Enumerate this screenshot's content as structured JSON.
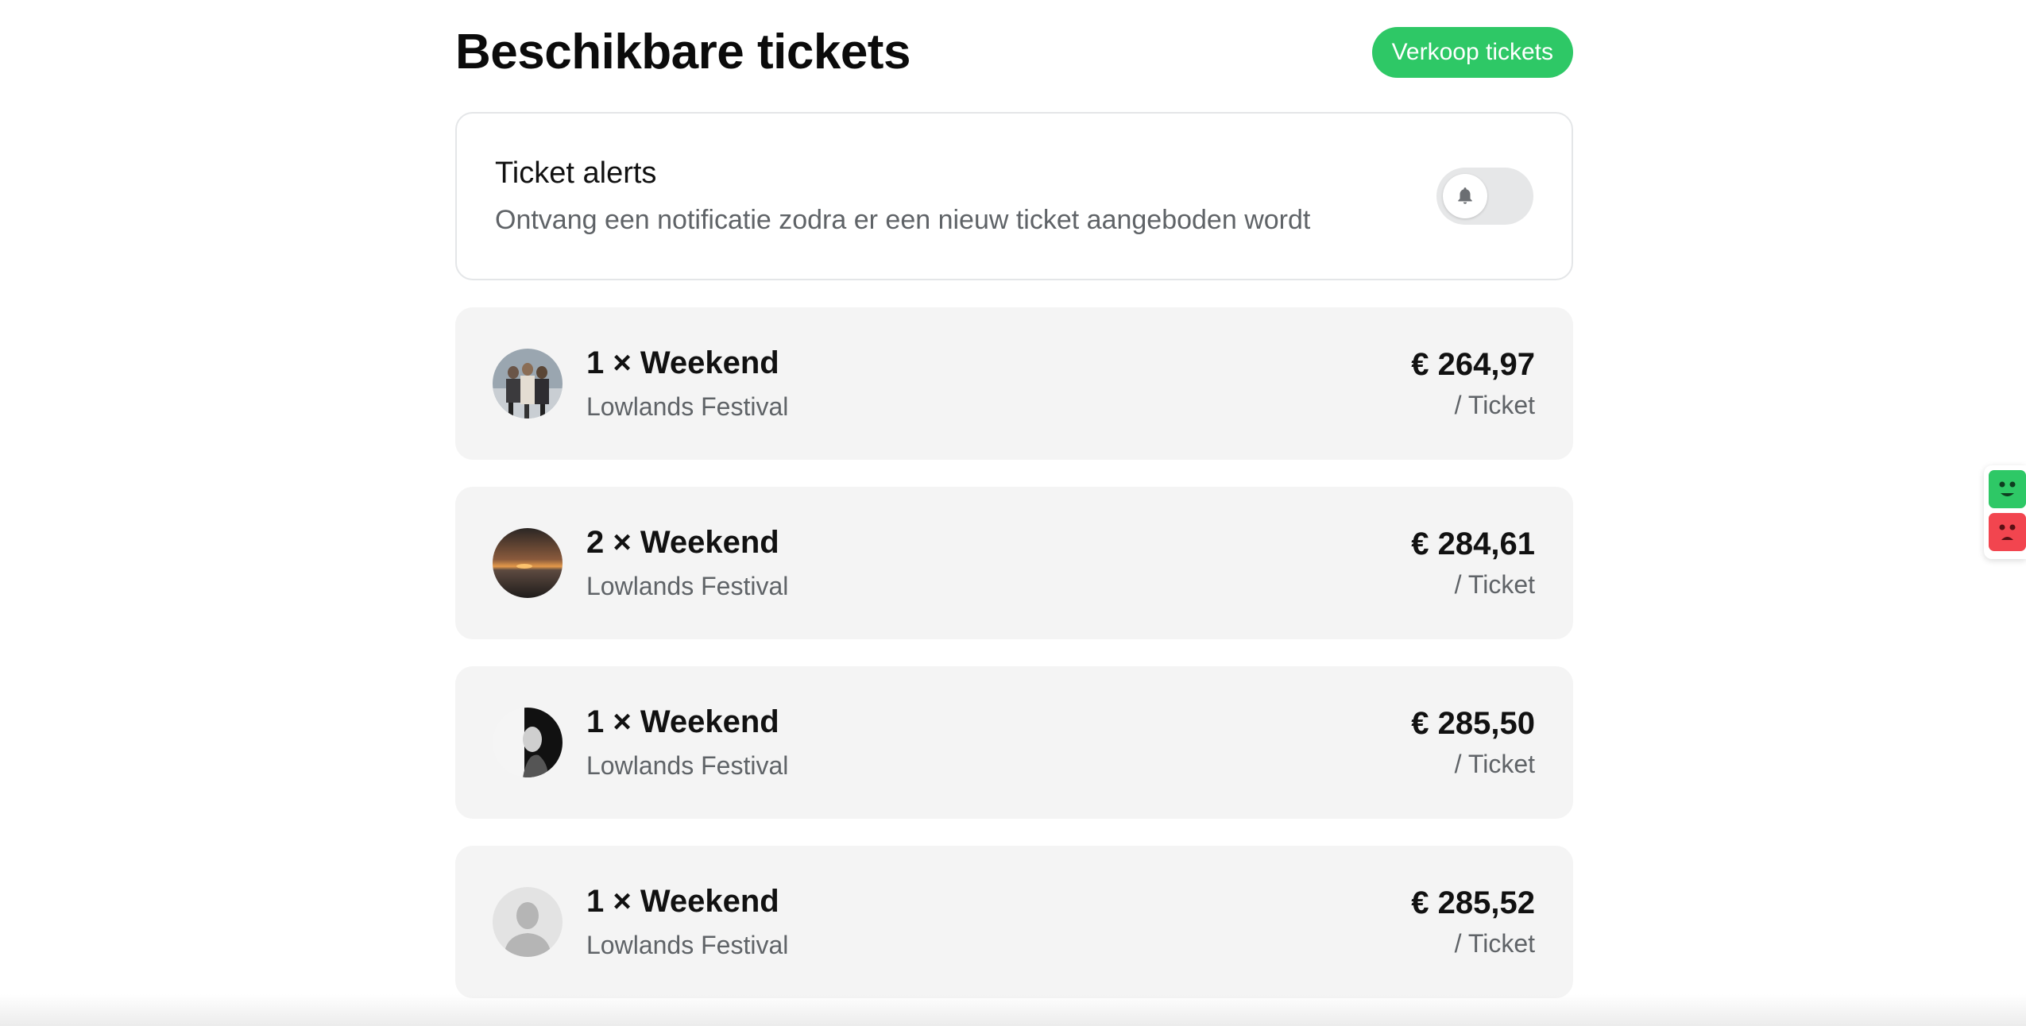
{
  "header": {
    "title": "Beschikbare tickets",
    "sell_button_label": "Verkoop tickets"
  },
  "alerts": {
    "title": "Ticket alerts",
    "description": "Ontvang een notificatie zodra er een nieuw ticket aangeboden wordt",
    "toggle_on": false,
    "toggle_icon": "bell-icon"
  },
  "tickets": [
    {
      "title": "1 × Weekend",
      "event": "Lowlands Festival",
      "price": "€ 264,97",
      "unit": "/ Ticket",
      "avatar": "group-photo"
    },
    {
      "title": "2 × Weekend",
      "event": "Lowlands Festival",
      "price": "€ 284,61",
      "unit": "/ Ticket",
      "avatar": "sunset-photo"
    },
    {
      "title": "1 × Weekend",
      "event": "Lowlands Festival",
      "price": "€ 285,50",
      "unit": "/ Ticket",
      "avatar": "bw-portrait-photo"
    },
    {
      "title": "1 × Weekend",
      "event": "Lowlands Festival",
      "price": "€ 285,52",
      "unit": "/ Ticket",
      "avatar": "default-user-icon"
    }
  ],
  "feedback": {
    "happy_icon": "happy-face-icon",
    "sad_icon": "sad-face-icon"
  },
  "colors": {
    "accent_green": "#2ec866",
    "sad_red": "#f2454f",
    "card_bg": "#f4f4f4",
    "muted_text": "#5f6367"
  }
}
